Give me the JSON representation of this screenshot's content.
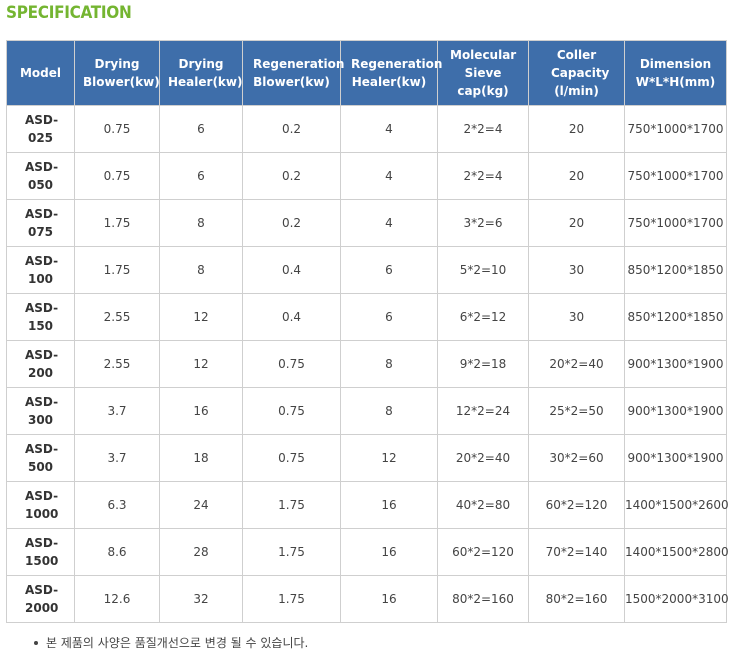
{
  "title": "SPECIFICATION",
  "table": {
    "headers": [
      "Model",
      "Drying Blower(kw)",
      "Drying Healer(kw)",
      "Regeneration Blower(kw)",
      "Regeneration Healer(kw)",
      "Molecular Sieve cap(kg)",
      "Coller Capacity (l/min)",
      "Dimension W*L*H(mm)"
    ],
    "rows": [
      [
        "ASD-025",
        "0.75",
        "6",
        "0.2",
        "4",
        "2*2=4",
        "20",
        "750*1000*1700"
      ],
      [
        "ASD-050",
        "0.75",
        "6",
        "0.2",
        "4",
        "2*2=4",
        "20",
        "750*1000*1700"
      ],
      [
        "ASD-075",
        "1.75",
        "8",
        "0.2",
        "4",
        "3*2=6",
        "20",
        "750*1000*1700"
      ],
      [
        "ASD-100",
        "1.75",
        "8",
        "0.4",
        "6",
        "5*2=10",
        "30",
        "850*1200*1850"
      ],
      [
        "ASD-150",
        "2.55",
        "12",
        "0.4",
        "6",
        "6*2=12",
        "30",
        "850*1200*1850"
      ],
      [
        "ASD-200",
        "2.55",
        "12",
        "0.75",
        "8",
        "9*2=18",
        "20*2=40",
        "900*1300*1900"
      ],
      [
        "ASD-300",
        "3.7",
        "16",
        "0.75",
        "8",
        "12*2=24",
        "25*2=50",
        "900*1300*1900"
      ],
      [
        "ASD-500",
        "3.7",
        "18",
        "0.75",
        "12",
        "20*2=40",
        "30*2=60",
        "900*1300*1900"
      ],
      [
        "ASD-1000",
        "6.3",
        "24",
        "1.75",
        "16",
        "40*2=80",
        "60*2=120",
        "1400*1500*2600"
      ],
      [
        "ASD-1500",
        "8.6",
        "28",
        "1.75",
        "16",
        "60*2=120",
        "70*2=140",
        "1400*1500*2800"
      ],
      [
        "ASD-2000",
        "12.6",
        "32",
        "1.75",
        "16",
        "80*2=160",
        "80*2=160",
        "1500*2000*3100"
      ]
    ]
  },
  "note": "본 제품의 사양은 품질개선으로 변경 될 수 있습니다.",
  "colors": {
    "title_green": "#74b531",
    "header_blue": "#3e6eaa",
    "border_gray": "#cfcfcf"
  }
}
